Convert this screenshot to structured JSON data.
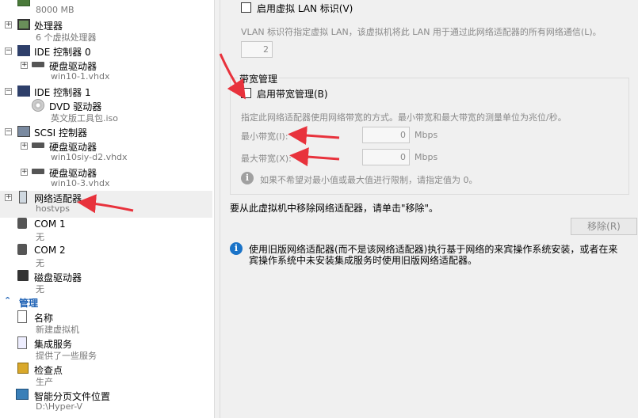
{
  "tree": {
    "memory_value": "8000 MB",
    "processor": {
      "label": "处理器",
      "sub": "6 个虚拟处理器"
    },
    "ide0": {
      "label": "IDE 控制器 0"
    },
    "ide0_disk": {
      "label": "硬盘驱动器",
      "sub": "win10-1.vhdx"
    },
    "ide1": {
      "label": "IDE 控制器 1"
    },
    "dvd": {
      "label": "DVD 驱动器",
      "sub": "英文版工具包.iso"
    },
    "scsi": {
      "label": "SCSI 控制器"
    },
    "scsi_disk1": {
      "label": "硬盘驱动器",
      "sub": "win10siy-d2.vhdx"
    },
    "scsi_disk2": {
      "label": "硬盘驱动器",
      "sub": "win10-3.vhdx"
    },
    "network": {
      "label": "网络适配器",
      "sub": "hostvps"
    },
    "com1": {
      "label": "COM 1",
      "sub": "无"
    },
    "com2": {
      "label": "COM 2",
      "sub": "无"
    },
    "floppy": {
      "label": "磁盘驱动器",
      "sub": "无"
    },
    "management_header": "管理",
    "name": {
      "label": "名称",
      "sub": "新建虚拟机"
    },
    "integration": {
      "label": "集成服务",
      "sub": "提供了一些服务"
    },
    "checkpoint": {
      "label": "检查点",
      "sub": "生产"
    },
    "paging": {
      "label": "智能分页文件位置",
      "sub": "D:\\Hyper-V"
    }
  },
  "right": {
    "vlan_checkbox_label": "启用虚拟 LAN 标识(V)",
    "vlan_desc": "VLAN 标识符指定虚拟 LAN，该虚拟机将此 LAN 用于通过此网络适配器的所有网络通信(L)。",
    "vlan_id": "2",
    "bandwidth_group": "带宽管理",
    "bandwidth_checkbox_label": "启用带宽管理(B)",
    "bandwidth_desc": "指定此网络适配器使用网络带宽的方式。最小带宽和最大带宽的测量单位为兆位/秒。",
    "min_label": "最小带宽(I):",
    "min_value": "0",
    "max_label": "最大带宽(X):",
    "max_value": "0",
    "unit": "Mbps",
    "limit_note": "如果不希望对最小值或最大值进行限制，请指定值为 0。",
    "remove_text": "要从此虚拟机中移除网络适配器，请单击\"移除\"。",
    "remove_button": "移除(R)",
    "legacy_info_line1": "使用旧版网络适配器(而不是该网络适配器)执行基于网络的来宾操作系统安装，或者在来",
    "legacy_info_line2": "宾操作系统中未安装集成服务时使用旧版网络适配器。"
  },
  "colors": {
    "accent": "#1a5fb4",
    "annotation_arrow": "#e8323c",
    "info_icon": "#1a73c8"
  }
}
